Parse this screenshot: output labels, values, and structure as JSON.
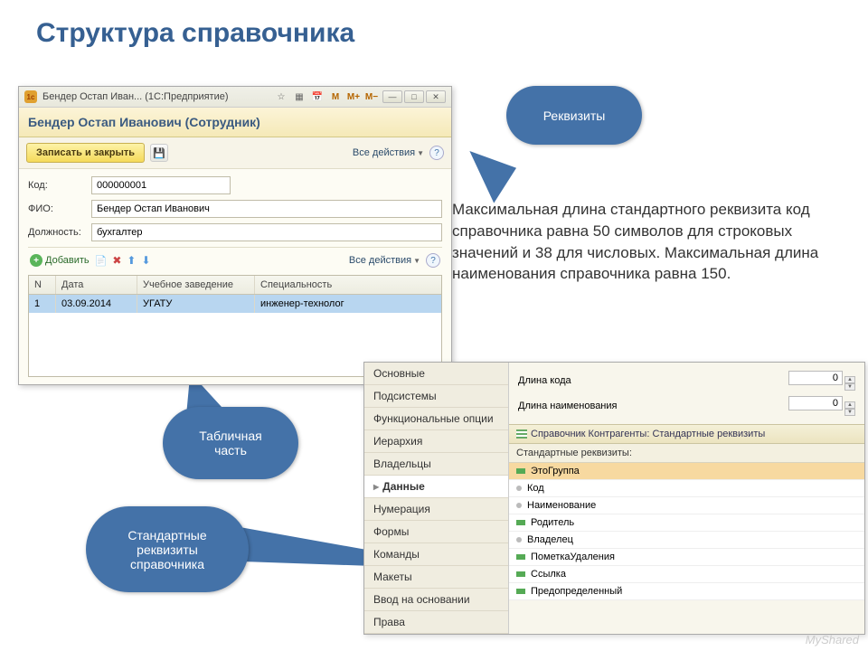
{
  "slide_title": "Структура справочника",
  "callouts": {
    "c1": "Реквизиты",
    "c2_l1": "Табличная",
    "c2_l2": "часть",
    "c3_l1": "Стандартные",
    "c3_l2": "реквизиты",
    "c3_l3": "справочника"
  },
  "body_text": "Максимальная длина стандартного реквизита код справочника равна 50 символов для строковых значений и 38 для числовых. Максимальная длина наименования справочника равна 150.",
  "win1": {
    "title": "Бендер Остап Иван... (1С:Предприятие)",
    "header": "Бендер Остап Иванович (Сотрудник)",
    "save_btn": "Записать и закрыть",
    "all_actions": "Все действия",
    "m_labels": {
      "m": "M",
      "mp": "M+",
      "mm": "M−"
    },
    "fields": {
      "code_l": "Код:",
      "code_v": "000000001",
      "fio_l": "ФИО:",
      "fio_v": "Бендер Остап Иванович",
      "pos_l": "Должность:",
      "pos_v": "бухгалтер"
    },
    "add_btn": "Добавить",
    "grid": {
      "cols": [
        "N",
        "Дата",
        "Учебное заведение",
        "Специальность"
      ],
      "row": [
        "1",
        "03.09.2014",
        "УГАТУ",
        "инженер-технолог"
      ]
    }
  },
  "win2": {
    "tabs": [
      "Основные",
      "Подсистемы",
      "Функциональные опции",
      "Иерархия",
      "Владельцы",
      "Данные",
      "Нумерация",
      "Формы",
      "Команды",
      "Макеты",
      "Ввод на основании",
      "Права"
    ],
    "active_tab": "Данные",
    "props": {
      "code_len_l": "Длина кода",
      "code_len_v": "0",
      "name_len_l": "Длина наименования",
      "name_len_v": "0"
    },
    "panel_title": "Справочник Контрагенты: Стандартные реквизиты",
    "std_label": "Стандартные реквизиты:",
    "std_items": [
      {
        "label": "ЭтоГруппа",
        "kind": "g",
        "sel": true
      },
      {
        "label": "Код",
        "kind": "d"
      },
      {
        "label": "Наименование",
        "kind": "d"
      },
      {
        "label": "Родитель",
        "kind": "g"
      },
      {
        "label": "Владелец",
        "kind": "d"
      },
      {
        "label": "ПометкаУдаления",
        "kind": "g"
      },
      {
        "label": "Ссылка",
        "kind": "g"
      },
      {
        "label": "Предопределенный",
        "kind": "g"
      }
    ]
  },
  "watermark": "MyShared"
}
